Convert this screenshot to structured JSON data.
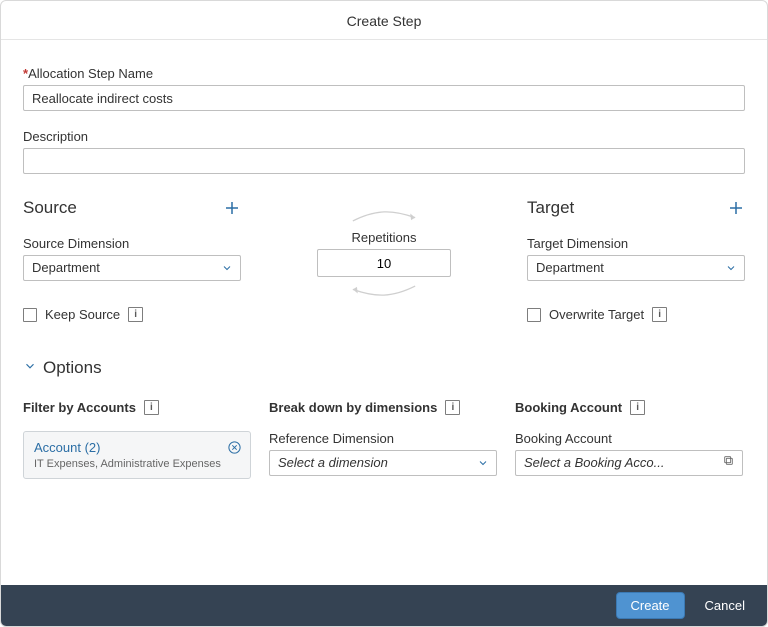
{
  "dialog": {
    "title": "Create Step"
  },
  "fields": {
    "allocation_label": "Allocation Step Name",
    "allocation_value": "Reallocate indirect costs",
    "description_label": "Description",
    "description_value": ""
  },
  "source": {
    "title": "Source",
    "dimension_label": "Source Dimension",
    "dimension_value": "Department",
    "keep_label": "Keep Source"
  },
  "repetitions": {
    "label": "Repetitions",
    "value": "10"
  },
  "target": {
    "title": "Target",
    "dimension_label": "Target Dimension",
    "dimension_value": "Department",
    "overwrite_label": "Overwrite Target"
  },
  "options": {
    "header": "Options",
    "filter": {
      "title": "Filter by Accounts",
      "chip_title": "Account (2)",
      "chip_sub": "IT Expenses, Administrative Expenses"
    },
    "breakdown": {
      "title": "Break down by dimensions",
      "ref_label": "Reference Dimension",
      "ref_placeholder": "Select a dimension"
    },
    "booking": {
      "title": "Booking Account",
      "acct_label": "Booking Account",
      "acct_placeholder": "Select a Booking Acco..."
    }
  },
  "footer": {
    "create": "Create",
    "cancel": "Cancel"
  }
}
